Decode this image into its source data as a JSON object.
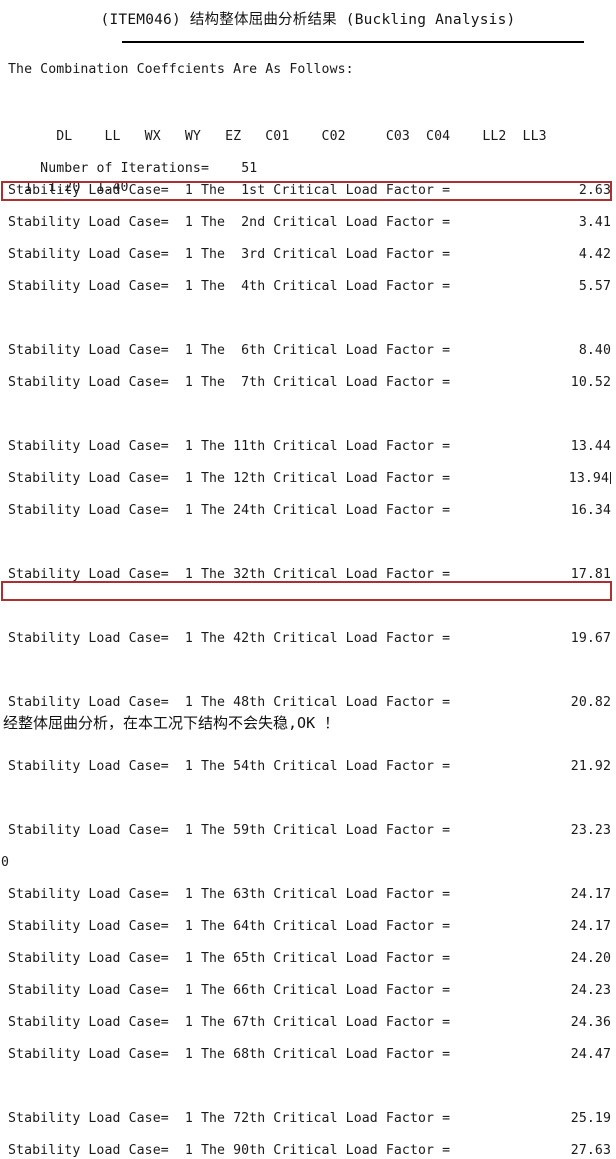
{
  "document": {
    "title": "(ITEM046) 结构整体屈曲分析结果 (Buckling Analysis)",
    "combination_heading": "The Combination Coeffcients Are As Follows:",
    "iterations_label": "Number of Iterations=",
    "iterations_value": "51",
    "conclusion": "经整体屈曲分析，在本工况下结构不会失稳,OK ！",
    "stray_overflow_char": "0"
  },
  "coefficient_table": {
    "header_row": "      DL    LL   WX   WY   EZ   C01    C02     C03  C04    LL2  LL3",
    "value_row": "  1  1.20  1.40",
    "columns": [
      "DL",
      "LL",
      "WX",
      "WY",
      "EZ",
      "C01",
      "C02",
      "C03",
      "C04",
      "LL2",
      "LL3"
    ],
    "rows": [
      {
        "index": "1",
        "values": [
          "1.20",
          "1.40",
          "",
          "",
          "",
          "",
          "",
          "",
          "",
          "",
          ""
        ]
      }
    ]
  },
  "colors": {
    "highlight_border": "#ae2f2f",
    "text": "#1a1a1a",
    "rule": "#000000"
  },
  "results": {
    "row_prefix": "Stability Load Case=",
    "load_case": "1",
    "mid_text": "The",
    "suffix": "Critical Load Factor =",
    "rows": [
      {
        "label": "Stability Load Case=  1 The  1st Critical Load Factor =",
        "value": "2.63",
        "mode": "line",
        "highlight": true
      },
      {
        "label": "Stability Load Case=  1 The  2nd Critical Load Factor =",
        "value": "3.41",
        "mode": "line"
      },
      {
        "label": "Stability Load Case=  1 The  3rd Critical Load Factor =",
        "value": "4.42",
        "mode": "line"
      },
      {
        "label": "Stability Load Case=  1 The  4th Critical Load Factor =",
        "value": "5.57",
        "mode": "line"
      },
      {
        "label": "",
        "value": "",
        "mode": "blank"
      },
      {
        "label": "Stability Load Case=  1 The  6th Critical Load Factor =",
        "value": "8.40",
        "mode": "line"
      },
      {
        "label": "Stability Load Case=  1 The  7th Critical Load Factor =",
        "value": "10.52",
        "mode": "line"
      },
      {
        "label": "",
        "value": "",
        "mode": "blank"
      },
      {
        "label": "Stability Load Case=  1 The 11th Critical Load Factor =",
        "value": "13.44",
        "mode": "line"
      },
      {
        "label": "Stability Load Case=  1 The 12th Critical Load Factor =",
        "value": "13.94",
        "mode": "line",
        "caret": true
      },
      {
        "label": "Stability Load Case=  1 The 24th Critical Load Factor =",
        "value": "16.34",
        "mode": "line"
      },
      {
        "label": "",
        "value": "",
        "mode": "blank"
      },
      {
        "label": "Stability Load Case=  1 The 32th Critical Load Factor =",
        "value": "17.81",
        "mode": "line"
      },
      {
        "label": "",
        "value": "",
        "mode": "blank"
      },
      {
        "label": "Stability Load Case=  1 The 42th Critical Load Factor =",
        "value": "19.67",
        "mode": "line"
      },
      {
        "label": "",
        "value": "",
        "mode": "blank"
      },
      {
        "label": "Stability Load Case=  1 The 48th Critical Load Factor =",
        "value": "20.82",
        "mode": "line"
      },
      {
        "label": "",
        "value": "",
        "mode": "blank"
      },
      {
        "label": "Stability Load Case=  1 The 54th Critical Load Factor =",
        "value": "21.92",
        "mode": "line"
      },
      {
        "label": "",
        "value": "",
        "mode": "blank"
      },
      {
        "label": "Stability Load Case=  1 The 59th Critical Load Factor =",
        "value": "23.23",
        "mode": "line"
      },
      {
        "label": "",
        "value": "",
        "mode": "stray"
      },
      {
        "label": "Stability Load Case=  1 The 63th Critical Load Factor =",
        "value": "24.17",
        "mode": "line"
      },
      {
        "label": "Stability Load Case=  1 The 64th Critical Load Factor =",
        "value": "24.17",
        "mode": "line"
      },
      {
        "label": "Stability Load Case=  1 The 65th Critical Load Factor =",
        "value": "24.20",
        "mode": "line"
      },
      {
        "label": "Stability Load Case=  1 The 66th Critical Load Factor =",
        "value": "24.23",
        "mode": "line",
        "highlight": true
      },
      {
        "label": "Stability Load Case=  1 The 67th Critical Load Factor =",
        "value": "24.36",
        "mode": "line"
      },
      {
        "label": "Stability Load Case=  1 The 68th Critical Load Factor =",
        "value": "24.47",
        "mode": "line"
      },
      {
        "label": "",
        "value": "",
        "mode": "blank"
      },
      {
        "label": "Stability Load Case=  1 The 72th Critical Load Factor =",
        "value": "25.19",
        "mode": "line"
      },
      {
        "label": "Stability Load Case=  1 The 90th Critical Load Factor =",
        "value": "27.63",
        "mode": "line"
      }
    ]
  }
}
